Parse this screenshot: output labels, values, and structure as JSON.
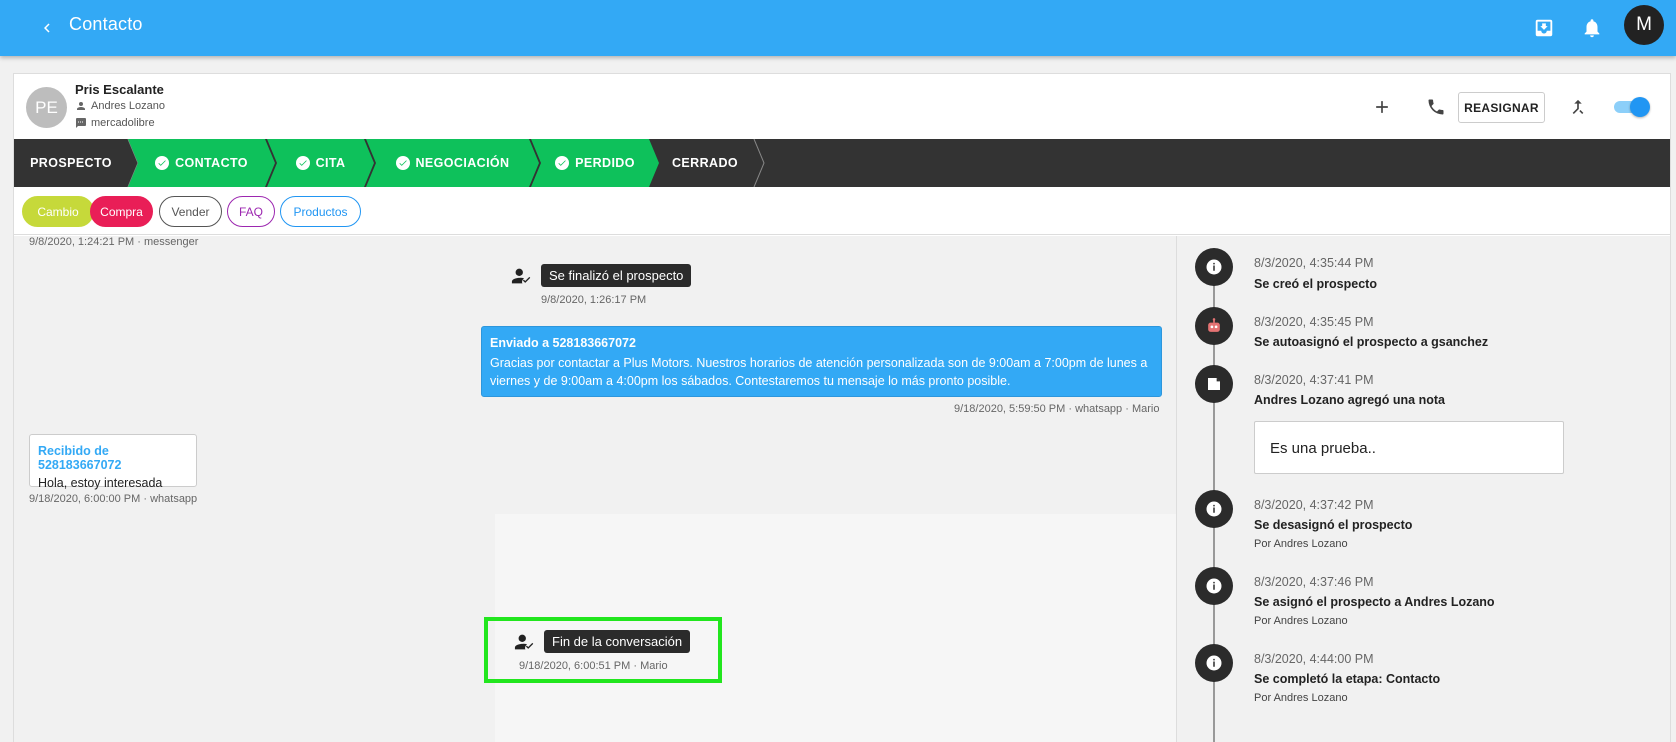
{
  "appbar": {
    "title": "Contacto",
    "avatar_letter": "M"
  },
  "contact": {
    "initials": "PE",
    "name": "Pris Escalante",
    "agent": "Andres Lozano",
    "source": "mercadolibre",
    "reassign_label": "REASIGNAR"
  },
  "stages": [
    {
      "label": "PROSPECTO",
      "done": false
    },
    {
      "label": "CONTACTO",
      "done": true
    },
    {
      "label": "CITA",
      "done": true
    },
    {
      "label": "NEGOCIACIÓN",
      "done": true
    },
    {
      "label": "PERDIDO",
      "done": true
    },
    {
      "label": "CERRADO",
      "done": false
    }
  ],
  "tags": [
    {
      "label": "Cambio",
      "color": "#c6d93a"
    },
    {
      "label": "Compra",
      "color": "#e91e57"
    },
    {
      "label": "Vender",
      "color": "#555555"
    },
    {
      "label": "FAQ",
      "color": "#9c27b0"
    },
    {
      "label": "Productos",
      "color": "#2196f3"
    }
  ],
  "chat": {
    "top_meta": "9/8/2020, 1:24:21 PM · messenger",
    "event1": {
      "label": "Se finalizó el prospecto",
      "meta": "9/8/2020, 1:26:17 PM"
    },
    "outgoing": {
      "header": "Enviado a 528183667072",
      "body": "Gracias por contactar a Plus Motors. Nuestros horarios de atención personalizada son de 9:00am a 7:00pm de lunes a viernes y de 9:00am a 4:00pm los sábados. Contestaremos tu mensaje lo más pronto posible.",
      "meta": "9/18/2020, 5:59:50 PM · whatsapp · Mario"
    },
    "incoming": {
      "header": "Recibido de 528183667072",
      "body": "Hola, estoy interesada",
      "meta": "9/18/2020, 6:00:00 PM · whatsapp"
    },
    "event2": {
      "label": "Fin de la conversación",
      "meta": "9/18/2020, 6:00:51 PM · Mario"
    }
  },
  "timeline": [
    {
      "time": "8/3/2020, 4:35:44 PM",
      "text": "Se creó el prospecto",
      "by": "",
      "icon": "info-icon"
    },
    {
      "time": "8/3/2020, 4:35:45 PM",
      "text": "Se autoasignó el prospecto a gsanchez",
      "by": "",
      "icon": "robot-icon"
    },
    {
      "time": "8/3/2020, 4:37:41 PM",
      "text": "Andres Lozano agregó una nota",
      "by": "",
      "icon": "note-icon",
      "note": "Es una prueba.."
    },
    {
      "time": "8/3/2020, 4:37:42 PM",
      "text": "Se desasignó el prospecto",
      "by": "Por Andres Lozano",
      "icon": "info-icon"
    },
    {
      "time": "8/3/2020, 4:37:46 PM",
      "text": "Se asignó el prospecto a Andres Lozano",
      "by": "Por Andres Lozano",
      "icon": "info-icon"
    },
    {
      "time": "8/3/2020, 4:44:00 PM",
      "text": "Se completó la etapa: Contacto",
      "by": "Por Andres Lozano",
      "icon": "info-icon"
    }
  ]
}
